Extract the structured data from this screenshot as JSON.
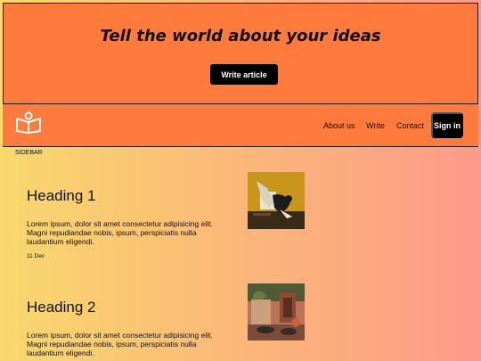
{
  "hero": {
    "title": "Tell the world about your ideas",
    "button_label": "Write article"
  },
  "nav": {
    "logo_icon": "open-book-icon",
    "links": [
      "About us",
      "Write",
      "Contact"
    ],
    "signin_label": "Sign in"
  },
  "sidebar": {
    "label": "SIDEBAR"
  },
  "articles": [
    {
      "heading": "Heading 1",
      "body": "Lorem ipsum, dolor sit amet consectetur adipisicing elit. Magni repudiandae nobis, ipsum, perspiciatis nulla laudantium eligendi.",
      "date": "11 Dec",
      "image": "dancer-photo"
    },
    {
      "heading": "Heading 2",
      "body": "Lorem ipsum, dolor sit amet consectetur adipisicing elit. Magni repudiandae nobis, ipsum, perspiciatis nulla laudantium eligendi.",
      "image": "courtyard-photo"
    }
  ],
  "colors": {
    "header_bg": "#ff7a3d",
    "gradient_left": "#f9d86d",
    "gradient_right": "#fd9a8a",
    "button_bg": "#000000"
  }
}
